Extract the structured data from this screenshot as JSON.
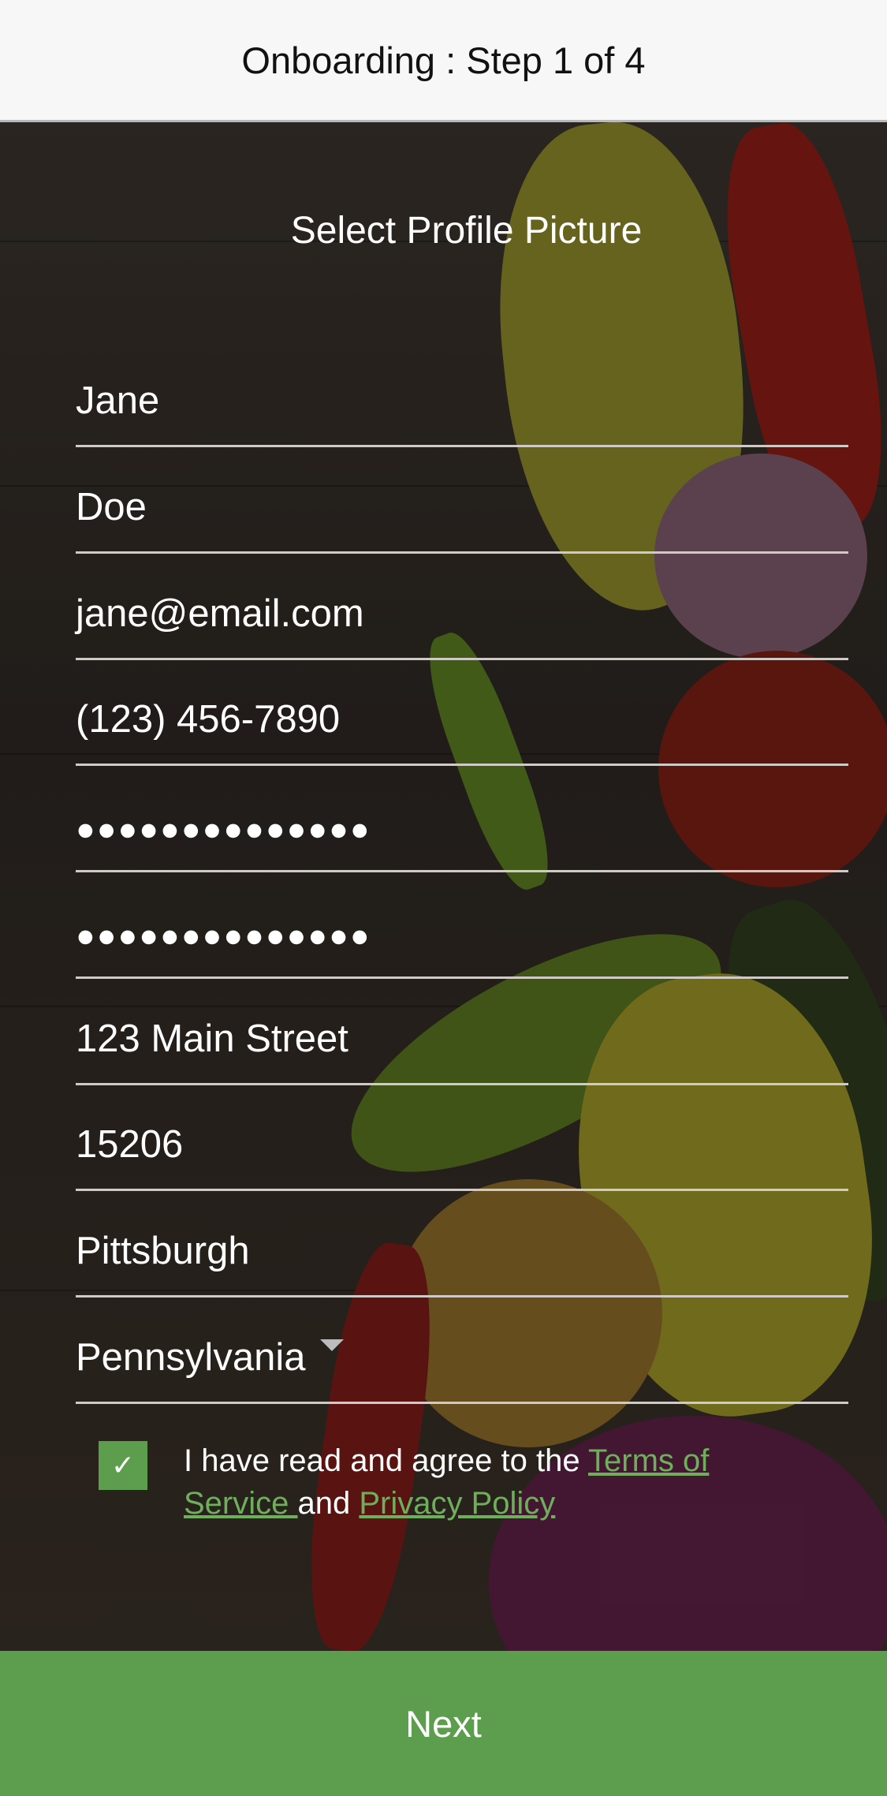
{
  "header": {
    "title": "Onboarding : Step 1 of 4"
  },
  "profile": {
    "select_label": "Select Profile Picture"
  },
  "fields": {
    "first_name": "Jane",
    "last_name": "Doe",
    "email": "jane@email.com",
    "phone": "(123) 456-7890",
    "password": "●●●●●●●●●●●●●●",
    "confirm_password": "●●●●●●●●●●●●●●",
    "street": "123 Main Street",
    "zip": "15206",
    "city": "Pittsburgh",
    "state": "Pennsylvania"
  },
  "agreement": {
    "checked": true,
    "prefix": "I have read and agree to the ",
    "terms_link": "Terms of Service ",
    "conjunction": "and ",
    "privacy_link": "Privacy Policy"
  },
  "footer": {
    "next_label": "Next"
  },
  "colors": {
    "accent": "#5d9e4e",
    "link": "#6fae5c",
    "header_bg": "#f7f7f7"
  },
  "icons": {
    "checkbox": "check-icon",
    "dropdown": "caret-down-icon"
  }
}
